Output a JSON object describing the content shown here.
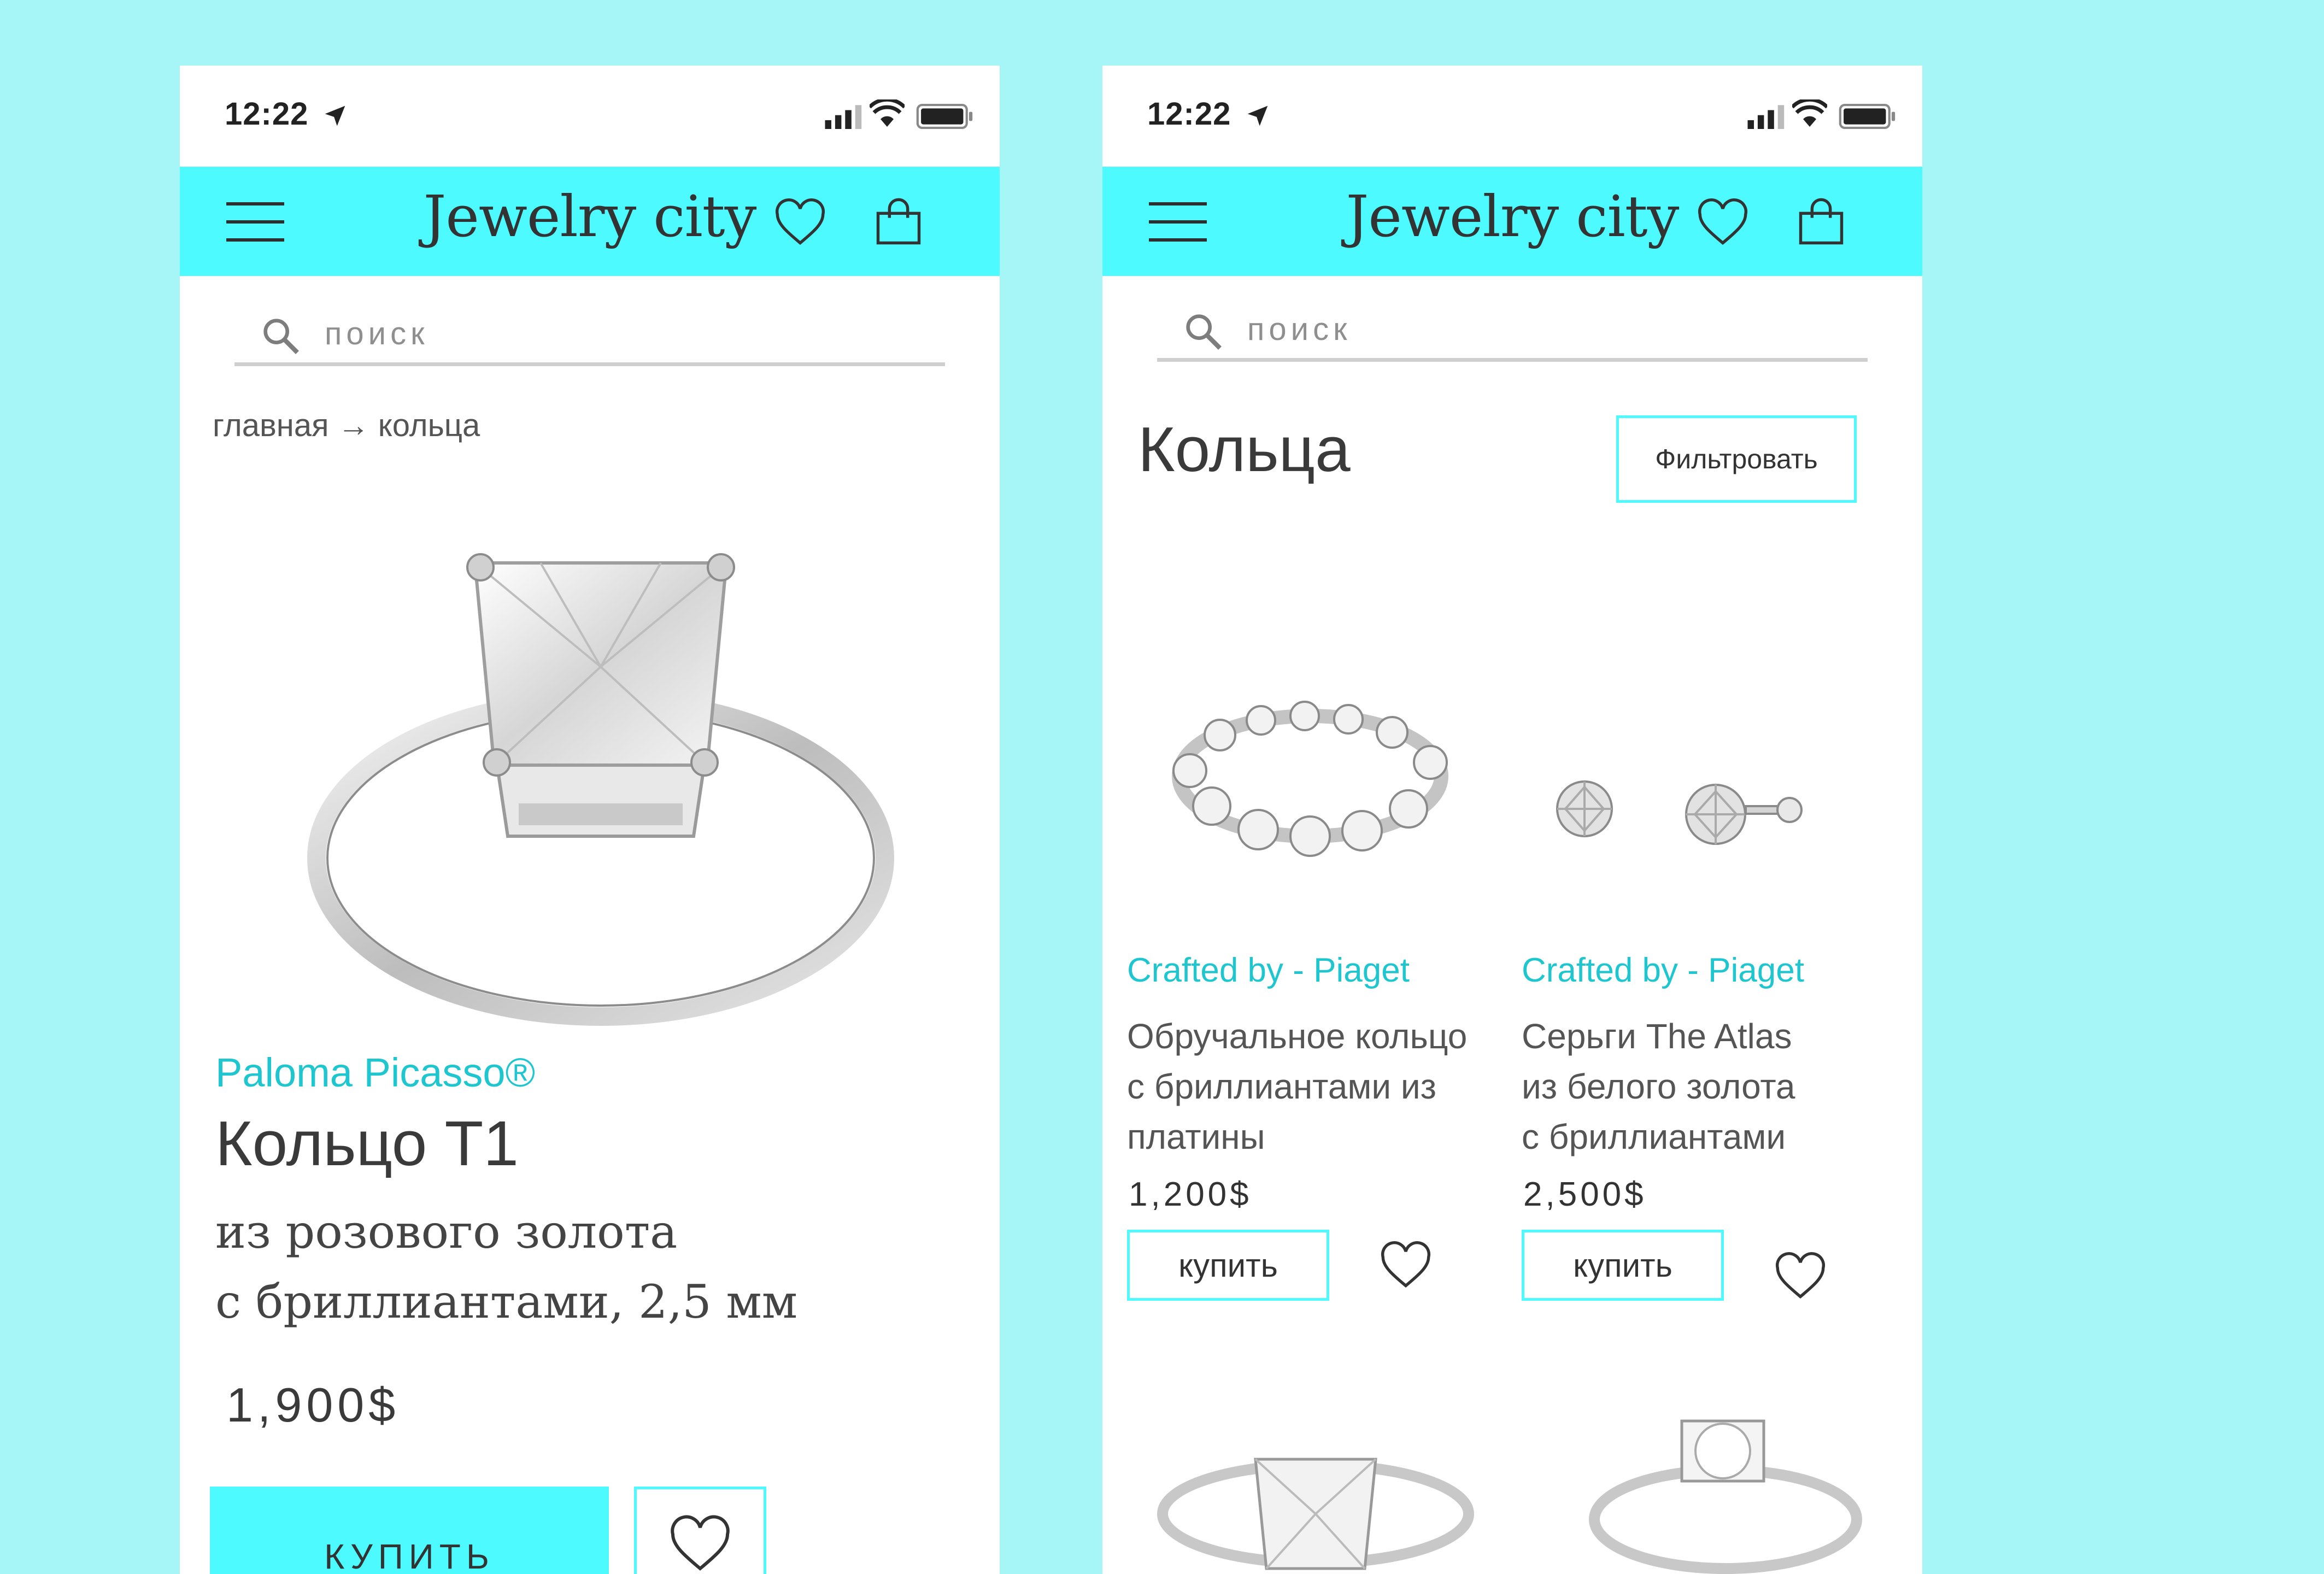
{
  "status_bar": {
    "time": "12:22"
  },
  "header": {
    "title": "Jewelry city"
  },
  "search": {
    "placeholder": "поиск"
  },
  "product_page": {
    "breadcrumb": "главная → кольца",
    "brand": "Paloma Picasso®",
    "title": "Кольцо Т1",
    "subtitle_line1": "из розового золота",
    "subtitle_line2": "с бриллиантами, 2,5 мм",
    "price": "1,900$",
    "buy_label": "КУПИТЬ"
  },
  "catalog_page": {
    "title": "Кольца",
    "filter_label": "Фильтровать",
    "items": [
      {
        "brand": "Crafted by - Piaget",
        "name_line1": "Обручальное кольцо",
        "name_line2": "с бриллиантами из",
        "name_line3": "платины",
        "price": "1,200$",
        "buy_label": "купить"
      },
      {
        "brand": "Crafted by - Piaget",
        "name_line1": "Серьги The Atlas",
        "name_line2": "из белого золота",
        "name_line3": "с бриллиантами",
        "price": "2,500$",
        "buy_label": "купить"
      }
    ]
  },
  "colors": {
    "page_background": "#a6f6f8",
    "header_background": "#4cfaff",
    "accent_text": "#1ec6cf"
  }
}
